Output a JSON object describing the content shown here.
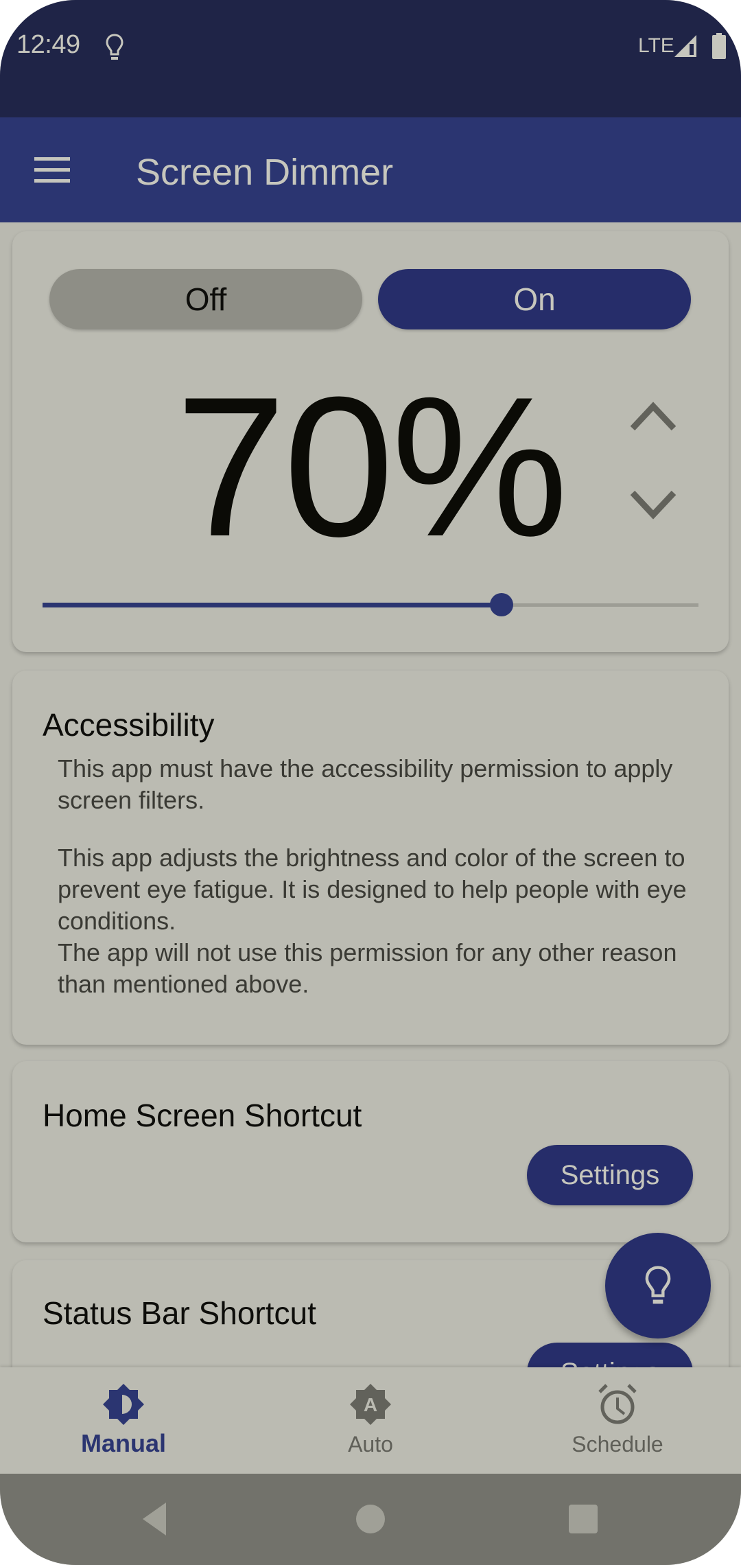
{
  "status_bar": {
    "time": "12:49",
    "network": "LTE",
    "icons": [
      "lightbulb-icon",
      "signal-icon",
      "battery-icon"
    ]
  },
  "app_bar": {
    "title": "Screen Dimmer",
    "menu_icon": "menu-icon"
  },
  "dimmer": {
    "off_label": "Off",
    "on_label": "On",
    "selected": "On",
    "percent_text": "70%",
    "level_percent": 70,
    "increase_icon": "chevron-up-icon",
    "decrease_icon": "chevron-down-icon"
  },
  "accessibility": {
    "title": "Accessibility",
    "paragraph1": "This app must have the accessibility permission to apply screen filters.",
    "paragraph2_line1": "This app adjusts the brightness and color of the screen to prevent eye fatigue. It is designed to help people with eye conditions.",
    "paragraph2_line2": "The app will not use this permission for any other reason than mentioned above."
  },
  "home_shortcut": {
    "title": "Home Screen Shortcut",
    "button_label": "Settings"
  },
  "statusbar_shortcut": {
    "title": "Status Bar Shortcut",
    "button_label": "Settings"
  },
  "fab": {
    "icon": "lightbulb-icon"
  },
  "bottom_nav": {
    "items": [
      {
        "label": "Manual",
        "icon": "brightness-manual-icon",
        "active": true
      },
      {
        "label": "Auto",
        "icon": "brightness-auto-icon",
        "active": false
      },
      {
        "label": "Schedule",
        "icon": "alarm-clock-icon",
        "active": false
      }
    ]
  },
  "colors": {
    "primary": "#2b3571",
    "primary_dark": "#1f2447",
    "surface": "#bbbbb2",
    "on_primary": "#c6c6bd"
  }
}
